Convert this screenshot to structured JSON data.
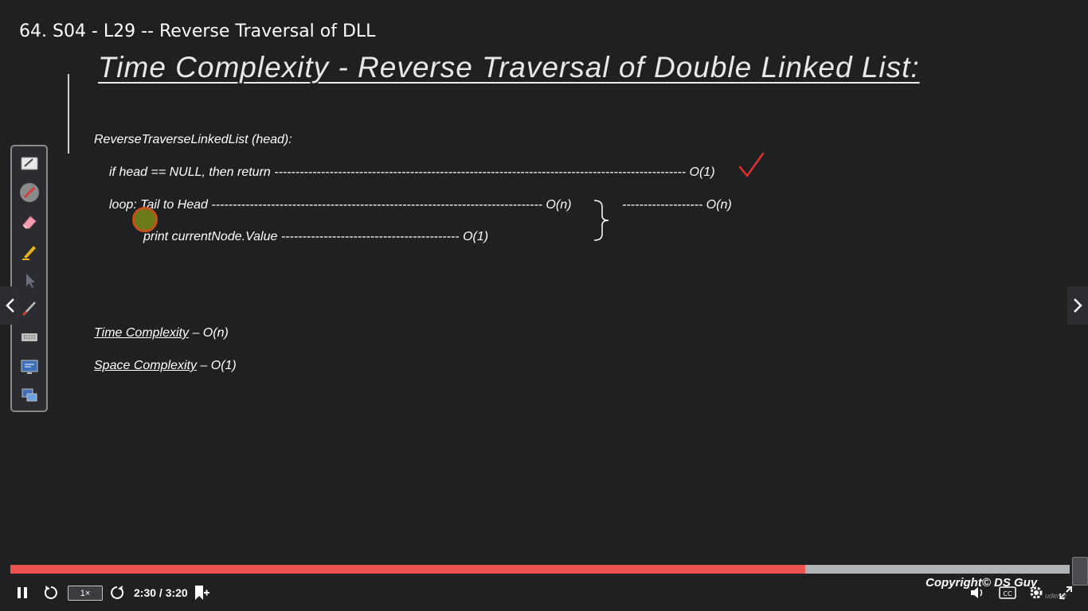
{
  "header": {
    "video_title": "64. S04 - L29 -- Reverse Traversal of DLL"
  },
  "slide": {
    "title": "Time Complexity - Reverse Traversal of Double Linked List:",
    "function_signature": "ReverseTraverseLinkedList (head):",
    "line_if": "if head == NULL, then return ------------------------------------------------------------------------------------------------- O(1)",
    "line_loop": "loop: Tail to Head ------------------------------------------------------------------------------ O(n)",
    "line_print": "print currentNode.Value ------------------------------------------ O(1)",
    "brace_result": "------------------- O(n)",
    "time_label": "Time Complexity",
    "time_value": " – O(n)",
    "space_label": "Space Complexity",
    "space_value": " – O(1)"
  },
  "toolbar": {
    "tools": [
      "whiteboard-icon",
      "pen-icon",
      "eraser-icon",
      "highlighter-icon",
      "pointer-icon",
      "brush-icon",
      "keyboard-icon",
      "screen-capture-icon",
      "screen-share-icon"
    ]
  },
  "player": {
    "progress": 0.75,
    "speed": "1×",
    "time": "2:30 / 3:20",
    "copyright": "Copyright© DS Guy",
    "watermark": "udemy"
  },
  "colors": {
    "accent": "#ec5252",
    "background": "#1e2022",
    "check": "#e03030"
  }
}
